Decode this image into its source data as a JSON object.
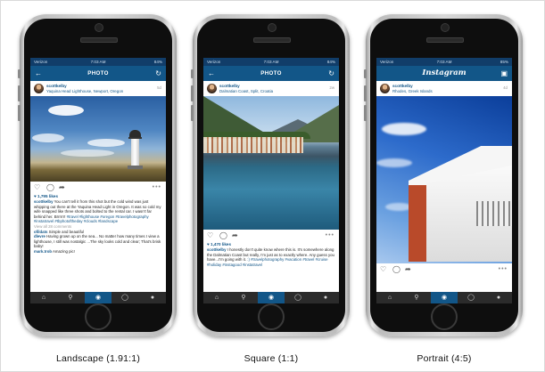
{
  "phones": [
    {
      "status": {
        "carrier": "Verizon",
        "time": "7:03 AM",
        "battery": "84%"
      },
      "appbar": {
        "title": "PHOTO",
        "left_icon": "back-arrow-icon",
        "right_icon": "refresh-icon"
      },
      "post": {
        "username": "scottkelby",
        "location": "Yaquina Head Lighthouse, Newport, Oregon",
        "ago": "5d",
        "likes": "1,795 likes",
        "caption_user": "scottkelby",
        "caption_text": "You can't tell it from this shot but the cold wind was just whipping out there at the Yaquina Head Light in Oregon. It was so cold my wife snapped like three shots and bolted to the rental car. I wasn't far behind her. Brrrrrr!",
        "caption_tags": "#travel #lighthouse #oregon #travelphotography #instatravel #tbphotoftheday #clouds #landscape",
        "view_all": "View all 28 comments",
        "comments": [
          {
            "user": "ofildats",
            "text": "Simple and beautiful"
          },
          {
            "user": "dlevre",
            "text": "Having grown up on the sea... No matter how many times I view a lighthouse, I still was nostalgic ...The sky looks cold and clear; That's brisk baby!"
          },
          {
            "user": "mark.trob",
            "text": "Amazing pic!"
          }
        ]
      },
      "label": "Landscape (1.91:1)"
    },
    {
      "status": {
        "carrier": "Verizon",
        "time": "7:03 AM",
        "battery": "84%"
      },
      "appbar": {
        "title": "PHOTO",
        "left_icon": "back-arrow-icon",
        "right_icon": "refresh-icon"
      },
      "post": {
        "username": "scottkelby",
        "location": "Dalmatian Coast, Split, Croatia",
        "ago": "2w",
        "likes": "1,470 likes",
        "caption_user": "scottkelby",
        "caption_text": "I honestly don't quite know where this is. It's somewhere along the Dalmatian Coast but really, I'm just as to exactly where. Any guess you have...I'm going with it.",
        "caption_tags": ":) #travelphotography #vacation #travel #cruise #holiday #instagood #instatravel"
      },
      "label": "Square (1:1)"
    },
    {
      "status": {
        "carrier": "Verizon",
        "time": "7:03 AM",
        "battery": "85%"
      },
      "appbar": {
        "title": "Instagram",
        "left_icon": "",
        "right_icon": "inbox-icon"
      },
      "post": {
        "username": "scottkelby",
        "location": "Rhodes, Greek Islands",
        "ago": "4d"
      },
      "label": "Portrait (4:5)"
    }
  ],
  "tabbar": [
    "home-icon",
    "search-icon",
    "camera-icon",
    "activity-icon",
    "profile-icon"
  ],
  "colors": {
    "brand": "#125688",
    "status": "#113d69",
    "tabbar": "#2b2b2b"
  }
}
